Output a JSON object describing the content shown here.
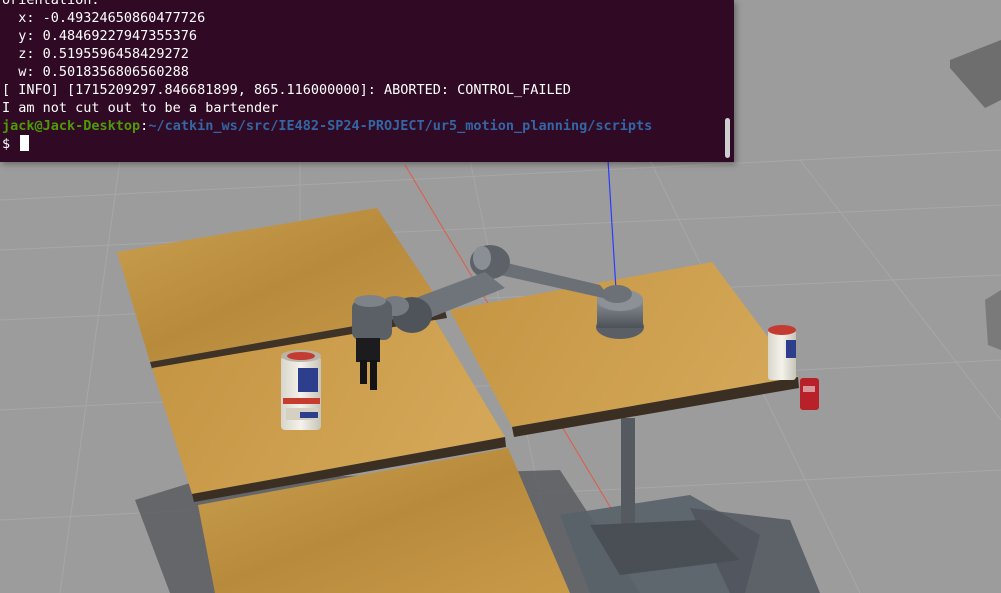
{
  "terminal": {
    "lines": [
      "orientation:",
      "  x: -0.49324650860477726",
      "  y: 0.48469227947355376",
      "  z: 0.5195596458429272",
      "  w: 0.5018356806560288",
      "[ INFO] [1715209297.846681899, 865.116000000]: ABORTED: CONTROL_FAILED",
      "I am not cut out to be a bartender"
    ],
    "prompt_user": "jack@Jack-Desktop",
    "prompt_sep": ":",
    "prompt_path": "~/catkin_ws/src/IE482-SP24-PROJECT/ur5_motion_planning/scripts",
    "prompt_symbol": "$"
  },
  "colors": {
    "terminal_bg": "#300a24",
    "prompt_user": "#4e9a06",
    "prompt_path": "#3465a4",
    "table_wood": "#c99a45",
    "ground": "#9a9a9a"
  }
}
